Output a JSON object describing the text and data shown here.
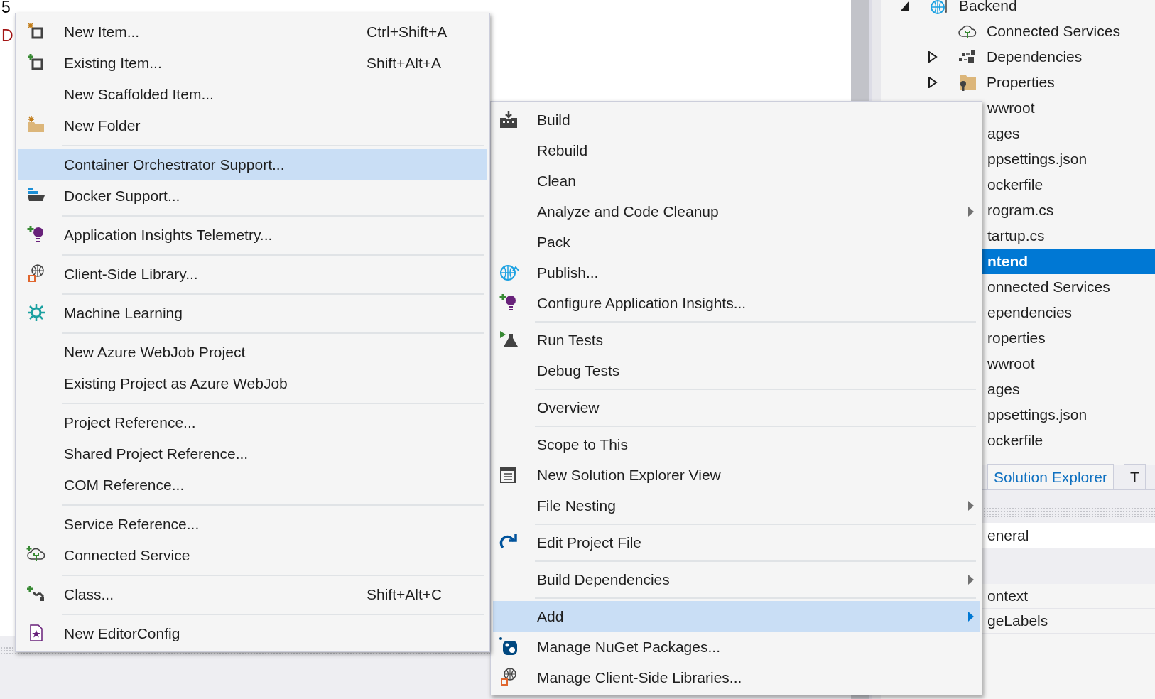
{
  "editor": {
    "lines": [
      {
        "text": "5",
        "kind": "plain"
      },
      {
        "text": "D",
        "kind": "error"
      }
    ]
  },
  "solution_explorer": {
    "tree": [
      {
        "label": "Backend",
        "expanded": true,
        "selected": false,
        "children": [
          {
            "label": "Connected Services",
            "selected": false
          },
          {
            "label": "Dependencies",
            "expanded": false,
            "selected": false
          },
          {
            "label": "Properties",
            "expanded": false,
            "selected": false
          },
          {
            "label": "wwroot",
            "selected": false
          },
          {
            "label": "ages",
            "selected": false
          },
          {
            "label": "ppsettings.json",
            "selected": false
          },
          {
            "label": "ockerfile",
            "selected": false
          },
          {
            "label": "rogram.cs",
            "selected": false
          },
          {
            "label": "tartup.cs",
            "selected": false
          }
        ]
      },
      {
        "label": "ntend",
        "selected": true,
        "children": [
          {
            "label": "onnected Services",
            "selected": false
          },
          {
            "label": "ependencies",
            "selected": false
          },
          {
            "label": "roperties",
            "selected": false
          },
          {
            "label": "wwroot",
            "selected": false
          },
          {
            "label": "ages",
            "selected": false
          },
          {
            "label": "ppsettings.json",
            "selected": false
          },
          {
            "label": "ockerfile",
            "selected": false
          }
        ]
      }
    ],
    "tabs": [
      {
        "label": "Solution Explorer",
        "selected": true
      },
      {
        "label": "T",
        "selected": false
      }
    ]
  },
  "properties": {
    "rows": [
      {
        "text": "eneral",
        "kind": "category"
      },
      {
        "text": "ontext",
        "kind": "property"
      },
      {
        "text": "geLabels",
        "kind": "property"
      }
    ]
  },
  "add_menu": {
    "groups": [
      {
        "items": [
          {
            "label": "New Item...",
            "shortcut": "Ctrl+Shift+A",
            "selected": false
          },
          {
            "label": "Existing Item...",
            "shortcut": "Shift+Alt+A",
            "selected": false
          },
          {
            "label": "New Scaffolded Item...",
            "selected": false
          },
          {
            "label": "New Folder",
            "selected": false
          }
        ]
      },
      {
        "items": [
          {
            "label": "Container Orchestrator Support...",
            "selected": true
          },
          {
            "label": "Docker Support...",
            "selected": false
          }
        ]
      },
      {
        "items": [
          {
            "label": "Application Insights Telemetry...",
            "selected": false
          }
        ]
      },
      {
        "items": [
          {
            "label": "Client-Side Library...",
            "selected": false
          }
        ]
      },
      {
        "items": [
          {
            "label": "Machine Learning",
            "selected": false
          }
        ]
      },
      {
        "items": [
          {
            "label": "New Azure WebJob Project",
            "selected": false
          },
          {
            "label": "Existing Project as Azure WebJob",
            "selected": false
          }
        ]
      },
      {
        "items": [
          {
            "label": "Project Reference...",
            "selected": false
          },
          {
            "label": "Shared Project Reference...",
            "selected": false
          },
          {
            "label": "COM Reference...",
            "selected": false
          }
        ]
      },
      {
        "items": [
          {
            "label": "Service Reference...",
            "selected": false
          },
          {
            "label": "Connected Service",
            "selected": false
          }
        ]
      },
      {
        "items": [
          {
            "label": "Class...",
            "shortcut": "Shift+Alt+C",
            "selected": false
          }
        ]
      },
      {
        "items": [
          {
            "label": "New EditorConfig",
            "selected": false
          }
        ]
      }
    ]
  },
  "project_menu": {
    "groups": [
      {
        "items": [
          {
            "label": "Build",
            "selected": false
          },
          {
            "label": "Rebuild",
            "selected": false
          },
          {
            "label": "Clean",
            "selected": false
          },
          {
            "label": "Analyze and Code Cleanup",
            "submenu": true,
            "selected": false
          },
          {
            "label": "Pack",
            "selected": false
          },
          {
            "label": "Publish...",
            "selected": false
          },
          {
            "label": "Configure Application Insights...",
            "selected": false
          }
        ]
      },
      {
        "items": [
          {
            "label": "Run Tests",
            "selected": false
          },
          {
            "label": "Debug Tests",
            "selected": false
          }
        ]
      },
      {
        "items": [
          {
            "label": "Overview",
            "selected": false
          }
        ]
      },
      {
        "items": [
          {
            "label": "Scope to This",
            "selected": false
          },
          {
            "label": "New Solution Explorer View",
            "selected": false
          },
          {
            "label": "File Nesting",
            "submenu": true,
            "selected": false
          }
        ]
      },
      {
        "items": [
          {
            "label": "Edit Project File",
            "selected": false
          }
        ]
      },
      {
        "items": [
          {
            "label": "Build Dependencies",
            "submenu": true,
            "selected": false
          }
        ]
      },
      {
        "items": [
          {
            "label": "Add",
            "submenu": true,
            "selected": true
          },
          {
            "label": "Manage NuGet Packages...",
            "selected": false
          },
          {
            "label": "Manage Client-Side Libraries...",
            "selected": false
          }
        ]
      }
    ]
  }
}
